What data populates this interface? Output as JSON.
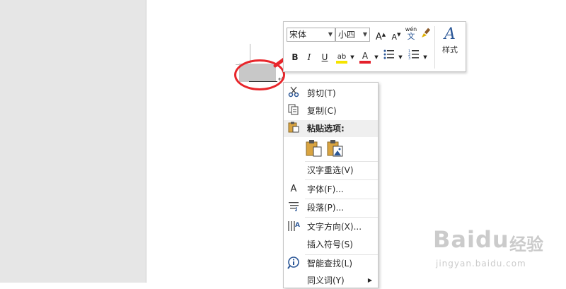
{
  "toolbar": {
    "font_name": "宋体",
    "font_size": "小四",
    "grow_font": "A",
    "shrink_font": "A",
    "phonetic_top": "wén",
    "phonetic_bottom": "文",
    "bold": "B",
    "italic": "I",
    "underline": "U",
    "highlight": "ab",
    "font_color": "A",
    "styles_glyph": "A",
    "styles_label": "样式",
    "highlight_color": "#f5e400",
    "font_color_value": "#e4202b"
  },
  "context_menu": {
    "items": [
      {
        "label": "剪切(T)",
        "icon": "scissors-icon"
      },
      {
        "label": "复制(C)",
        "icon": "copy-icon"
      },
      {
        "label": "粘贴选项:",
        "icon": "clipboard-icon"
      },
      {
        "label": "汉字重选(V)",
        "icon": ""
      },
      {
        "label": "字体(F)...",
        "icon": "font-icon"
      },
      {
        "label": "段落(P)...",
        "icon": "paragraph-icon"
      },
      {
        "label": "文字方向(X)...",
        "icon": "text-direction-icon"
      },
      {
        "label": "插入符号(S)",
        "icon": ""
      },
      {
        "label": "智能查找(L)",
        "icon": "info-icon"
      },
      {
        "label": "同义词(Y)",
        "icon": ""
      }
    ],
    "font_icon_glyph": "A"
  },
  "document": {
    "paragraph_mark": "↵"
  },
  "watermark": {
    "brand": "Baidu",
    "cn": "经验",
    "url": "jingyan.baidu.com"
  },
  "colors": {
    "annotation_red": "#e8262b",
    "accent_blue": "#2b5797"
  }
}
